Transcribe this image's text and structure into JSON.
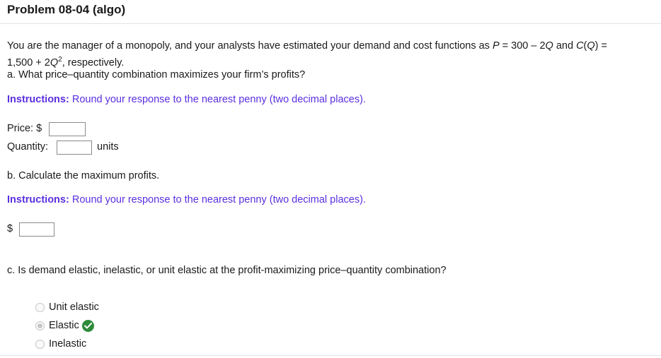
{
  "header": {
    "title": "Problem 08-04 (algo)"
  },
  "problem": {
    "intro_line1": "You are the manager of a monopoly, and your analysts have estimated your demand and cost functions as P = 300 – 2Q and C(Q) =",
    "intro_line2": "1,500 + 2Q², respectively.",
    "part_a": "a. What price–quantity combination maximizes your firm’s profits?",
    "instructions_label": "Instructions:",
    "instructions_text": "Round your response to the nearest penny (two decimal places).",
    "price_label": "Price: $",
    "price_value": "",
    "quantity_label": "Quantity:",
    "quantity_value": "",
    "units_label": "units",
    "part_b": "b. Calculate the maximum profits.",
    "profit_currency": "$",
    "profit_value": "",
    "part_c": "c. Is demand elastic, inelastic, or unit elastic at the profit-maximizing price–quantity combination?",
    "options": [
      {
        "label": "Unit elastic",
        "selected": false
      },
      {
        "label": "Elastic",
        "selected": true,
        "correct": true
      },
      {
        "label": "Inelastic",
        "selected": false
      }
    ]
  },
  "colors": {
    "instructions": "#5a2fe0",
    "correct": "#2e8b3a"
  }
}
